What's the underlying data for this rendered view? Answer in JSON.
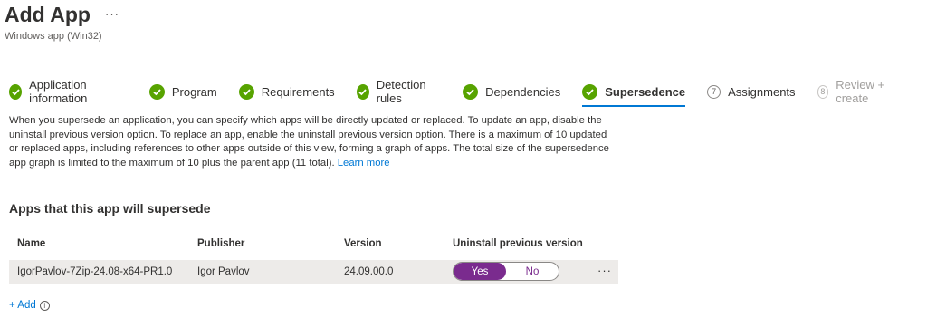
{
  "header": {
    "title": "Add App",
    "more": "···",
    "subtitle": "Windows app (Win32)"
  },
  "wizard": {
    "steps": [
      {
        "label": "Application information",
        "state": "done"
      },
      {
        "label": "Program",
        "state": "done"
      },
      {
        "label": "Requirements",
        "state": "done"
      },
      {
        "label": "Detection rules",
        "state": "done"
      },
      {
        "label": "Dependencies",
        "state": "done"
      },
      {
        "label": "Supersedence",
        "state": "active"
      },
      {
        "label": "Assignments",
        "state": "todo",
        "number": "7"
      },
      {
        "label": "Review + create",
        "state": "disabled",
        "number": "8"
      }
    ]
  },
  "description": {
    "text": "When you supersede an application, you can specify which apps will be directly updated or replaced. To update an app, disable the uninstall previous version option. To replace an app, enable the uninstall previous version option. There is a maximum of 10 updated or replaced apps, including references to other apps outside of this view, forming a graph of apps. The total size of the supersedence app graph is limited to the maximum of 10 plus the parent app (11 total).",
    "link": "Learn more"
  },
  "section_title": "Apps that this app will supersede",
  "table": {
    "columns": [
      "Name",
      "Publisher",
      "Version",
      "Uninstall previous version"
    ],
    "rows": [
      {
        "name": "IgorPavlov-7Zip-24.08-x64-PR1.0",
        "publisher": "Igor Pavlov",
        "version": "24.09.00.0",
        "toggle_on": "Yes",
        "toggle_off": "No",
        "more": "···"
      }
    ]
  },
  "add_link": "+ Add",
  "info_icon": "i",
  "colors": {
    "accent": "#0078d4",
    "done": "#57a300",
    "toggle": "#7a2b8e"
  }
}
